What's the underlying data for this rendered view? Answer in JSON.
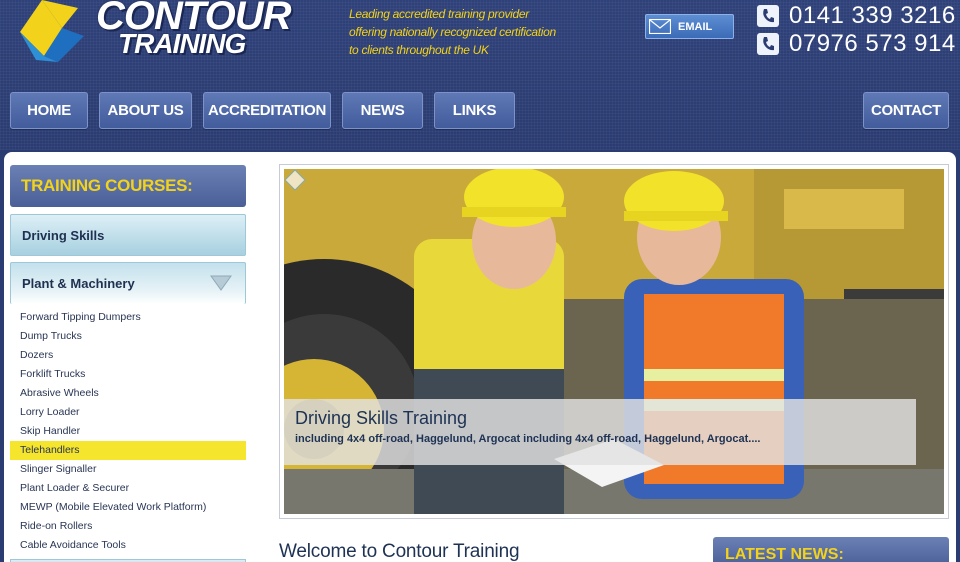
{
  "header": {
    "logo_line1": "CONTOUR",
    "logo_line2": "TRAINING",
    "tagline": [
      "Leading accredited training provider",
      "offering nationally recognized certification",
      "to clients throughout the UK"
    ],
    "email_label": "EMAIL",
    "phones": [
      "0141 339 3216",
      "07976 573 914"
    ]
  },
  "nav": {
    "items": [
      "HOME",
      "ABOUT US",
      "ACCREDITATION",
      "NEWS",
      "LINKS"
    ],
    "contact": "CONTACT"
  },
  "sidebar": {
    "heading": "TRAINING COURSES:",
    "categories": [
      "Driving Skills",
      "Plant & Machinery"
    ],
    "plant_items": [
      "Forward Tipping Dumpers",
      "Dump Trucks",
      "Dozers",
      "Forklift Trucks",
      "Abrasive Wheels",
      "Lorry Loader",
      "Skip Handler",
      "Telehandlers",
      "Slinger Signaller",
      "Plant Loader & Securer",
      "MEWP (Mobile Elevated Work Platform)",
      "Ride-on Rollers",
      "Cable Avoidance Tools"
    ],
    "active_item": "Telehandlers"
  },
  "hero": {
    "caption_title": "Driving Skills Training",
    "caption_sub": "including 4x4 off-road, Haggelund, Argocat including 4x4 off-road, Haggelund, Argocat...."
  },
  "main": {
    "welcome_title": "Welcome to Contour Training"
  },
  "news": {
    "heading": "LATEST NEWS:"
  },
  "colors": {
    "header_bg": "#2b3c72",
    "accent_yellow": "#f2d21a",
    "nav_button": "#5f79b6",
    "text_dark": "#1e3254"
  }
}
